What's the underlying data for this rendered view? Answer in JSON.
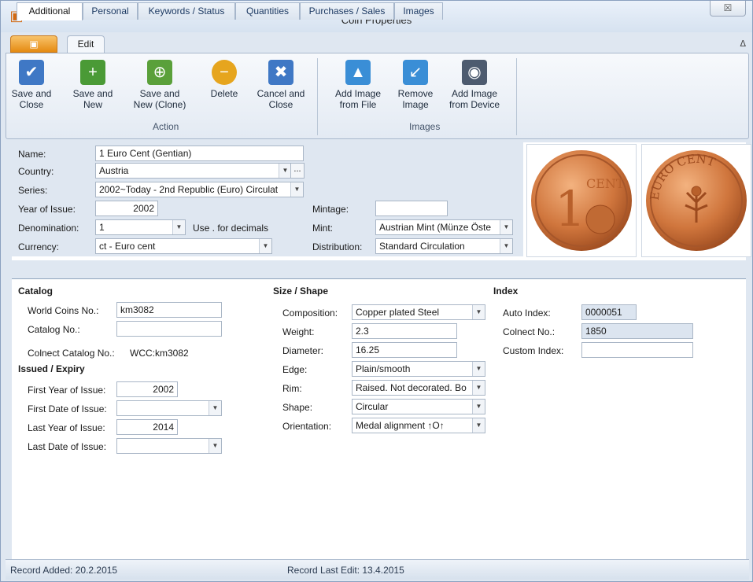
{
  "window": {
    "title": "Coin Properties",
    "close_glyph": "☒",
    "collapse_glyph": "ᐃ"
  },
  "tabs": {
    "edit": "Edit"
  },
  "ribbon": {
    "save_close": "Save and Close",
    "save_new": "Save and New",
    "save_new_clone": "Save and New (Clone)",
    "delete": "Delete",
    "cancel_close": "Cancel and Close",
    "group_action": "Action",
    "add_image_file": "Add Image from File",
    "remove_image": "Remove Image",
    "add_image_device": "Add Image from Device",
    "group_images": "Images"
  },
  "header": {
    "name_label": "Name:",
    "name_value": "1 Euro Cent (Gentian)",
    "country_label": "Country:",
    "country_value": "Austria",
    "series_label": "Series:",
    "series_value": "2002~Today - 2nd Republic (Euro) Circulat",
    "year_label": "Year of Issue:",
    "year_value": "2002",
    "denom_label": "Denomination:",
    "denom_value": "1",
    "denom_hint": "Use . for decimals",
    "currency_label": "Currency:",
    "currency_value": "ct - Euro cent",
    "mintage_label": "Mintage:",
    "mintage_value": "",
    "mint_label": "Mint:",
    "mint_value": "Austrian Mint (Münze Öste",
    "distribution_label": "Distribution:",
    "distribution_value": "Standard Circulation",
    "ellipsis": "..."
  },
  "detail_tabs": [
    "Additional",
    "Personal",
    "Keywords / Status",
    "Quantities",
    "Purchases / Sales",
    "Images"
  ],
  "catalog": {
    "title": "Catalog",
    "wc_label": "World Coins No.:",
    "wc_value": "km3082",
    "cat_label": "Catalog No.:",
    "cat_value": "",
    "colnect_label": "Colnect Catalog No.:",
    "colnect_value": "WCC:km3082"
  },
  "issued": {
    "title": "Issued / Expiry",
    "first_year_label": "First Year of Issue:",
    "first_year_value": "2002",
    "first_date_label": "First Date of Issue:",
    "first_date_value": "",
    "last_year_label": "Last Year of Issue:",
    "last_year_value": "2014",
    "last_date_label": "Last Date of Issue:",
    "last_date_value": ""
  },
  "size": {
    "title": "Size / Shape",
    "composition_label": "Composition:",
    "composition_value": "Copper plated Steel",
    "weight_label": "Weight:",
    "weight_value": "2.3",
    "diameter_label": "Diameter:",
    "diameter_value": "16.25",
    "edge_label": "Edge:",
    "edge_value": "Plain/smooth",
    "rim_label": "Rim:",
    "rim_value": "Raised. Not decorated. Bo",
    "shape_label": "Shape:",
    "shape_value": "Circular",
    "orientation_label": "Orientation:",
    "orientation_value": "Medal alignment ↑O↑"
  },
  "index": {
    "title": "Index",
    "auto_label": "Auto Index:",
    "auto_value": "0000051",
    "colnect_label": "Colnect No.:",
    "colnect_value": "1850",
    "custom_label": "Custom Index:",
    "custom_value": ""
  },
  "coin": {
    "obverse_text": "CENT",
    "obverse_numeral": "1",
    "reverse_text": "EURO CENT"
  },
  "status": {
    "added": "Record Added: 20.2.2015",
    "edited": "Record Last Edit: 13.4.2015"
  }
}
